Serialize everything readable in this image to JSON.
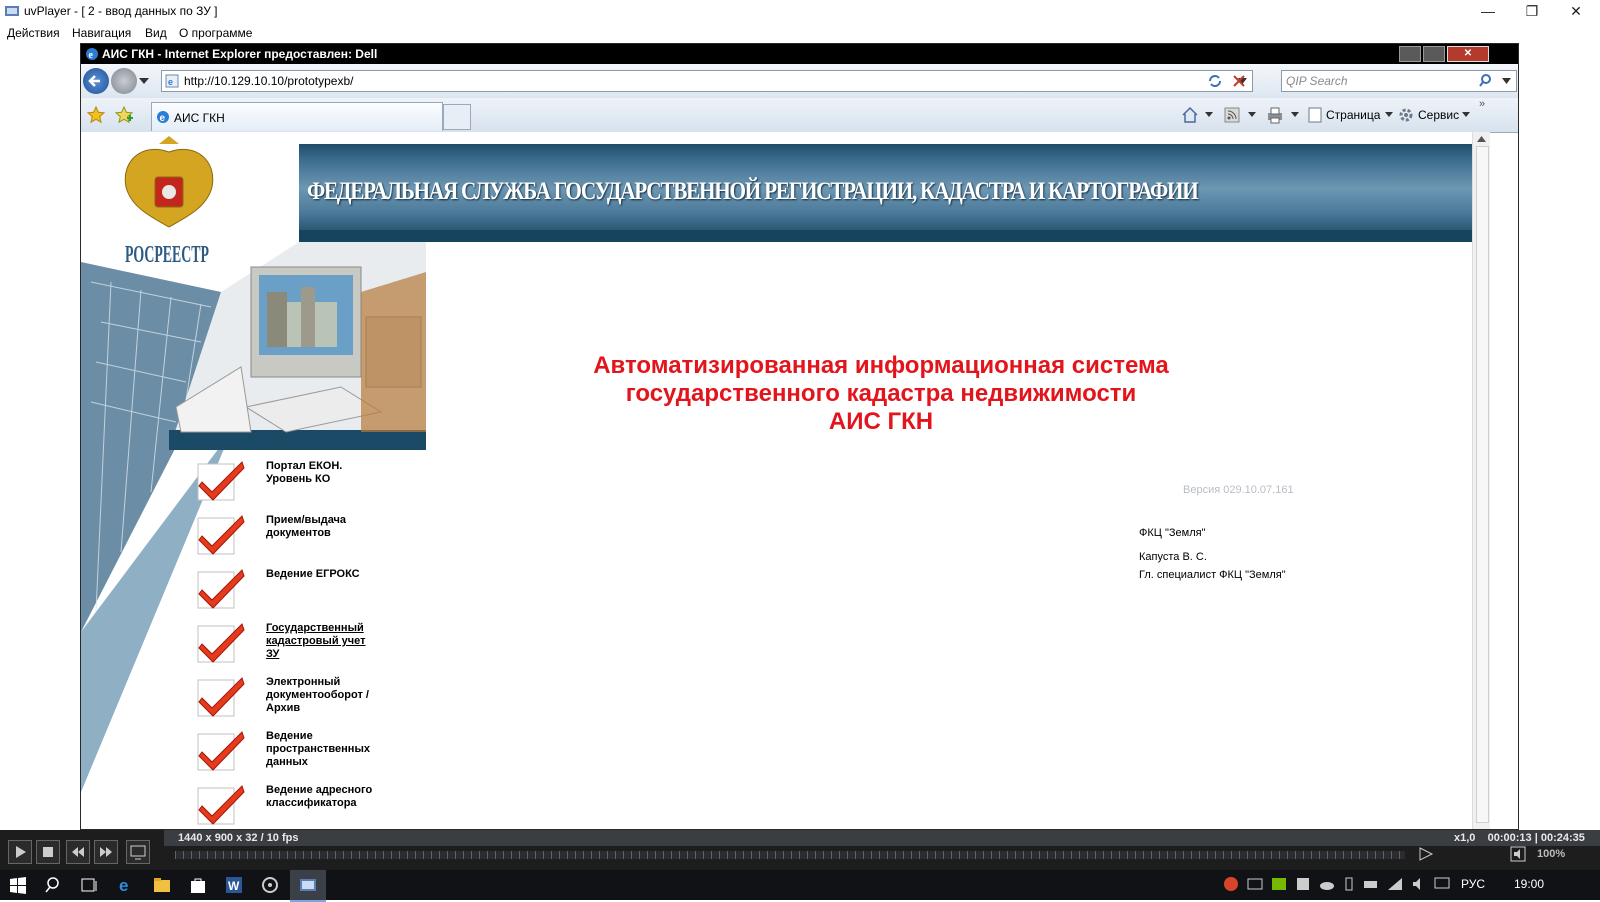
{
  "player": {
    "title": "uvPlayer - [ 2 - ввод данных по ЗУ ]",
    "menu": [
      "Действия",
      "Навигация",
      "Вид",
      "О программе"
    ],
    "info_left": "1440 x 900 x 32 / 10 fps",
    "info_right": "x1,0    00:00:13 | 00:24:35",
    "volume": "100%"
  },
  "browser": {
    "title": "АИС ГКН - Internet Explorer предоставлен: Dell",
    "url": "http://10.129.10.10/prototypexb/",
    "search_placeholder": "QIP Search",
    "tab_label": "АИС ГКН",
    "toolbar": {
      "page": "Страница",
      "service": "Сервис"
    }
  },
  "page": {
    "header": "ФЕДЕРАЛЬНАЯ СЛУЖБА ГОСУДАРСТВЕННОЙ РЕГИСТРАЦИИ, КАДАСТРА И КАРТОГРАФИИ",
    "logo_text": "РОСРЕЕСТР",
    "title_lines": [
      "Автоматизированная информационная система",
      "государственного кадастра недвижимости",
      "АИС ГКН"
    ],
    "version": "Версия 029.10.07.161",
    "org": "ФКЦ \"Земля\"",
    "author_name": "Капуста В. С.",
    "author_role": "Гл. специалист ФКЦ \"Земля\"",
    "menu": [
      {
        "label": "Портал ЕКОН.\nУровень КО",
        "link": false
      },
      {
        "label": "Прием/выдача\nдокументов",
        "link": false
      },
      {
        "label": "Ведение ЕГРОКС",
        "link": false
      },
      {
        "label": "Государственный\nкадастровый учет\nЗУ",
        "link": true
      },
      {
        "label": "Электронный\nдокументооборот /\nАрхив",
        "link": false
      },
      {
        "label": "Ведение\nпространственных\nданных",
        "link": false
      },
      {
        "label": "Ведение адресного\nклассификатора",
        "link": false
      }
    ]
  },
  "taskbar": {
    "lang": "РУС",
    "time": "19:00"
  }
}
